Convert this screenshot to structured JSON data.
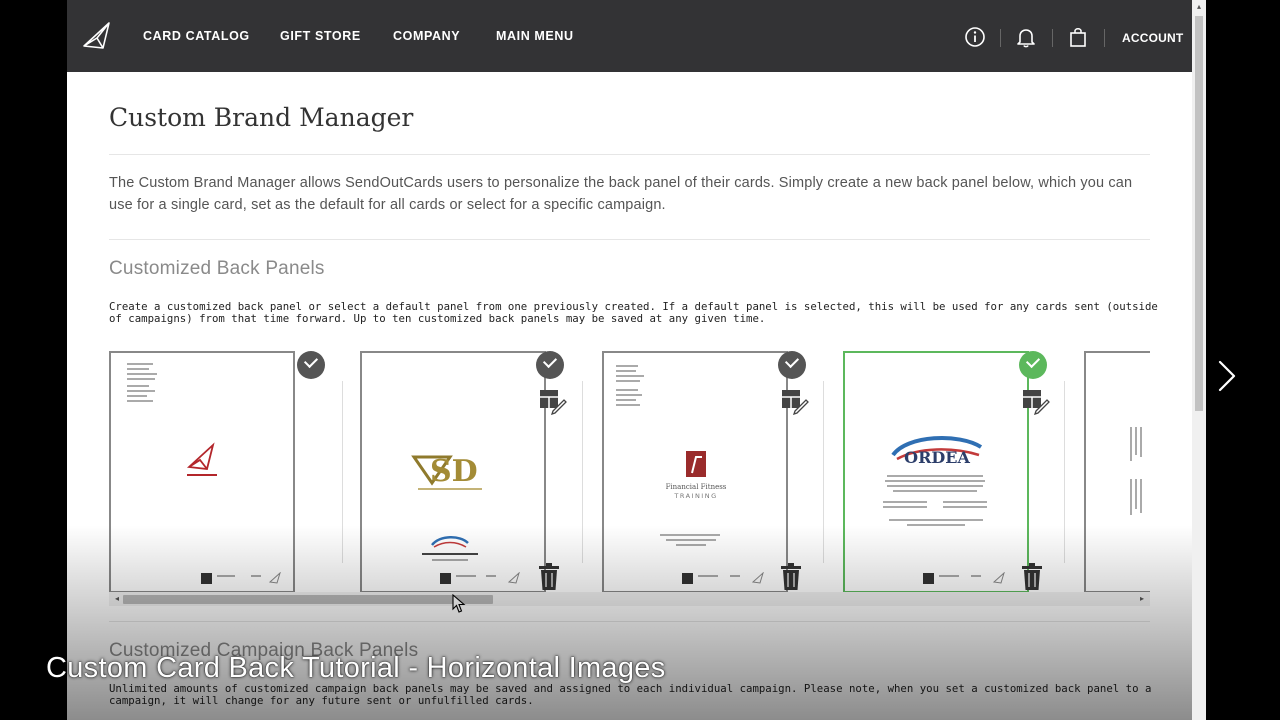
{
  "nav": {
    "links": [
      "CARD CATALOG",
      "GIFT STORE",
      "COMPANY",
      "MAIN MENU"
    ],
    "account": "ACCOUNT"
  },
  "page": {
    "title": "Custom Brand Manager",
    "intro": "The Custom Brand Manager allows SendOutCards users to personalize the back panel of their cards. Simply create a new back panel below, which you can use for a single card, set as the default for all cards or select for a specific campaign.",
    "section_title": "Customized Back Panels",
    "section_desc": "Create a customized back panel or select a default panel from one previously created. If a default panel is selected, this will be used for any cards sent (outside of campaigns) from that time forward. Up to ten customized back panels may be saved at any given time.",
    "campaign_title": "Customized Campaign Back Panels",
    "campaign_desc": "Unlimited amounts of customized campaign back panels may be saved and assigned to each individual campaign. Please note, when you set a customized back panel to a campaign, it will change for any future sent or unfulfilled cards."
  },
  "panels": [
    {
      "logo": "SendOutCards",
      "selected": false
    },
    {
      "logo": "SD",
      "selected": false
    },
    {
      "logo": "Financial Fitness TRAINING",
      "selected": false
    },
    {
      "logo": "ORDEA",
      "selected": true
    }
  ],
  "caption": "Custom Card Back Tutorial - Horizontal Images",
  "colors": {
    "nav_bg": "#333335",
    "selected": "#5cb85c",
    "check_default": "#555555"
  }
}
